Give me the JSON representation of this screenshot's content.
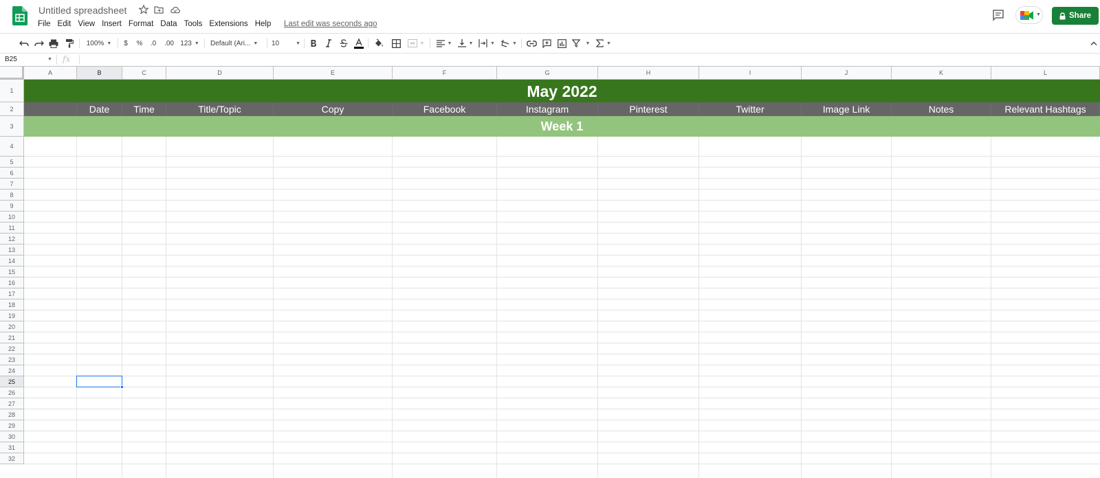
{
  "title_bar": {
    "document_title": "Untitled spreadsheet",
    "last_edit": "Last edit was seconds ago",
    "share_label": "Share",
    "accent_color": "#188038"
  },
  "menu": [
    "File",
    "Edit",
    "View",
    "Insert",
    "Format",
    "Data",
    "Tools",
    "Extensions",
    "Help"
  ],
  "toolbar": {
    "zoom": "100%",
    "currency": "$",
    "percent": "%",
    "decrease_decimal": ".0",
    "increase_decimal": ".00",
    "more_formats": "123",
    "font_family": "Default (Ari...",
    "font_size": "10"
  },
  "formula_bar": {
    "cell_reference": "B25",
    "fx": "fx",
    "value": ""
  },
  "sheet": {
    "columns": [
      "A",
      "B",
      "C",
      "D",
      "E",
      "F",
      "G",
      "H",
      "I",
      "J",
      "K",
      "L"
    ],
    "selected_column": "B",
    "selected_row": "25",
    "rows": [
      "1",
      "2",
      "3",
      "4",
      "5",
      "6",
      "7",
      "8",
      "9",
      "10",
      "11",
      "12",
      "13",
      "14",
      "15",
      "16",
      "17",
      "18",
      "19",
      "20",
      "21",
      "22",
      "23",
      "24",
      "25",
      "26",
      "27",
      "28",
      "29",
      "30",
      "31",
      "32"
    ],
    "title_text": "May 2022",
    "title_color": "#38761d",
    "header_color": "#666666",
    "week_color": "#93c47d",
    "headers": [
      "",
      "Date",
      "Time",
      "Title/Topic",
      "Copy",
      "Facebook",
      "Instagram",
      "Pinterest",
      "Twitter",
      "Image Link",
      "Notes",
      "Relevant Hashtags"
    ],
    "week_label": "Week 1"
  }
}
